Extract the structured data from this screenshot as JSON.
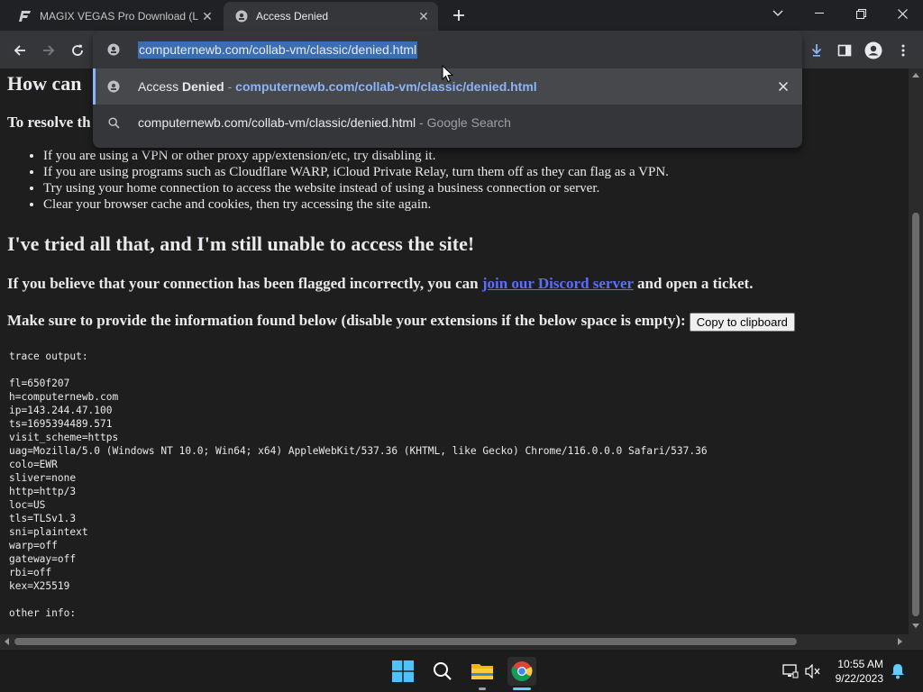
{
  "browser": {
    "tabs": [
      {
        "title": "MAGIX VEGAS Pro Download (La",
        "icon": "vegas-favicon"
      },
      {
        "title": "Access Denied",
        "icon": "shield-favicon",
        "active": true
      }
    ],
    "omnibox": {
      "url": "computernewb.com/collab-vm/classic/denied.html",
      "suggestions": [
        {
          "title_prefix": "Access ",
          "title_bold": "Denied",
          "separator": " - ",
          "url": "computernewb.com/collab-vm/classic/denied.html"
        },
        {
          "query": "computernewb.com/collab-vm/classic/denied.html",
          "separator": " - ",
          "suffix": "Google Search"
        }
      ]
    }
  },
  "page": {
    "heading_partial": "How can",
    "resolve_partial": "To resolve th",
    "tips": [
      "If you are using a VPN or other proxy app/extension/etc, try disabling it.",
      "If you are using programs such as Cloudflare WARP, iCloud Private Relay, turn them off as they can flag as a VPN.",
      "Try using your home connection to access the website instead of using a business connection or server.",
      "Clear your browser cache and cookies, then try accessing the site again."
    ],
    "heading2": "I've tried all that, and I'm still unable to access the site!",
    "flagged_prefix": "If you believe that your connection has been flagged incorrectly, you can ",
    "flagged_link": "join our Discord server",
    "flagged_suffix": " and open a ticket.",
    "info_text": "Make sure to provide the information found below (disable your extensions if the below space is empty):",
    "copy_button": "Copy to clipboard",
    "trace": "trace output:\n\nfl=650f207\nh=computernewb.com\nip=143.244.47.100\nts=1695394489.571\nvisit_scheme=https\nuag=Mozilla/5.0 (Windows NT 10.0; Win64; x64) AppleWebKit/537.36 (KHTML, like Gecko) Chrome/116.0.0.0 Safari/537.36\ncolo=EWR\nsliver=none\nhttp=http/3\nloc=US\ntls=TLSv1.3\nsni=plaintext\nwarp=off\ngateway=off\nrbi=off\nkex=X25519\n\nother info:"
  },
  "taskbar": {
    "time": "10:55 AM",
    "date": "9/22/2023",
    "apps": [
      "windows-start-icon",
      "search-icon",
      "file-explorer-icon",
      "chrome-icon"
    ]
  },
  "colors": {
    "accent": "#8ab4f8",
    "page_bg": "#1e1e1e",
    "link": "#5b6dff"
  }
}
